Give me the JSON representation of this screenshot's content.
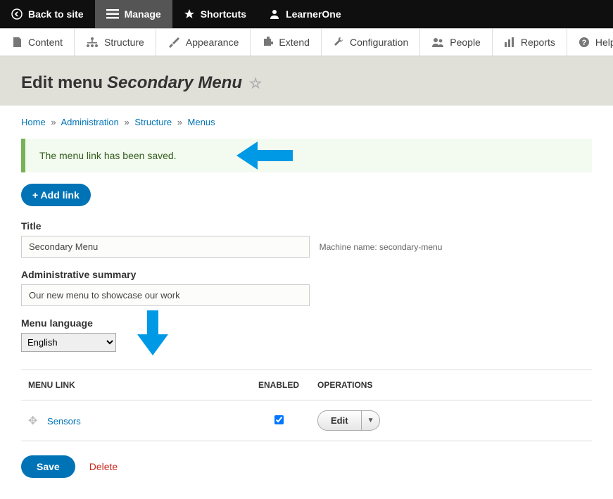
{
  "toolbar": {
    "back": "Back to site",
    "manage": "Manage",
    "shortcuts": "Shortcuts",
    "user": "LearnerOne"
  },
  "admin_menu": {
    "content": "Content",
    "structure": "Structure",
    "appearance": "Appearance",
    "extend": "Extend",
    "configuration": "Configuration",
    "people": "People",
    "reports": "Reports",
    "help": "Help"
  },
  "header": {
    "prefix": "Edit menu",
    "title": "Secondary Menu"
  },
  "breadcrumb": {
    "home": "Home",
    "admin": "Administration",
    "structure": "Structure",
    "menus": "Menus"
  },
  "message": "The menu link has been saved.",
  "buttons": {
    "add_link": "+ Add link",
    "save": "Save",
    "delete": "Delete",
    "edit": "Edit"
  },
  "form": {
    "title_label": "Title",
    "title_value": "Secondary Menu",
    "machine_name_label": "Machine name:",
    "machine_name_value": "secondary-menu",
    "summary_label": "Administrative summary",
    "summary_value": "Our new menu to showcase our work",
    "language_label": "Menu language",
    "language_value": "English"
  },
  "table": {
    "col_menu_link": "MENU LINK",
    "col_enabled": "ENABLED",
    "col_operations": "OPERATIONS",
    "rows": [
      {
        "title": "Sensors",
        "enabled": true
      }
    ]
  }
}
